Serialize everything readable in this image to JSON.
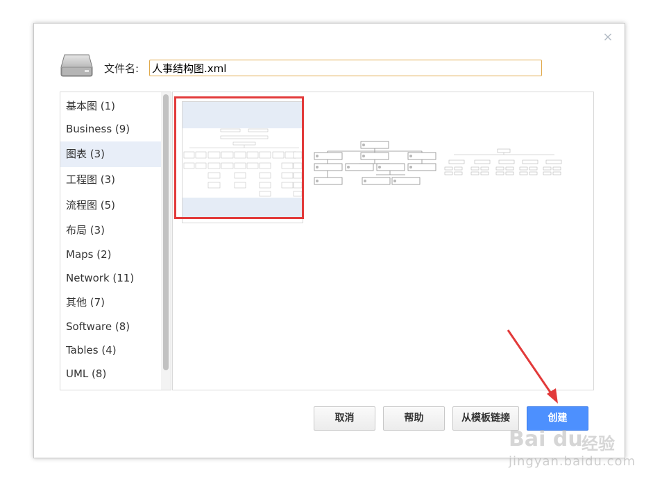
{
  "dialog": {
    "close_glyph": "×",
    "filename_label": "文件名:",
    "filename_value": "人事结构图.xml"
  },
  "categories": [
    {
      "label": "基本图 (1)"
    },
    {
      "label": "Business (9)"
    },
    {
      "label": "图表 (3)",
      "selected": true
    },
    {
      "label": "工程图 (3)"
    },
    {
      "label": "流程图 (5)"
    },
    {
      "label": "布局 (3)"
    },
    {
      "label": "Maps (2)"
    },
    {
      "label": "Network (11)"
    },
    {
      "label": "其他 (7)"
    },
    {
      "label": "Software (8)"
    },
    {
      "label": "Tables (4)"
    },
    {
      "label": "UML (8)"
    }
  ],
  "templates": [
    {
      "icon": "org-chart-detailed-icon",
      "selected": true
    },
    {
      "icon": "org-chart-boxes-icon"
    },
    {
      "icon": "org-chart-wide-icon"
    }
  ],
  "buttons": {
    "cancel": "取消",
    "help": "帮助",
    "template_link": "从模板链接",
    "create": "创建"
  },
  "watermark": {
    "logo": "Bai du",
    "text": "经验",
    "url": "jingyan.baidu.com"
  },
  "colors": {
    "accent": "#4d90fe",
    "selection": "#e8eef8",
    "highlight": "#e23a3a",
    "input_border": "#e0a94b"
  }
}
